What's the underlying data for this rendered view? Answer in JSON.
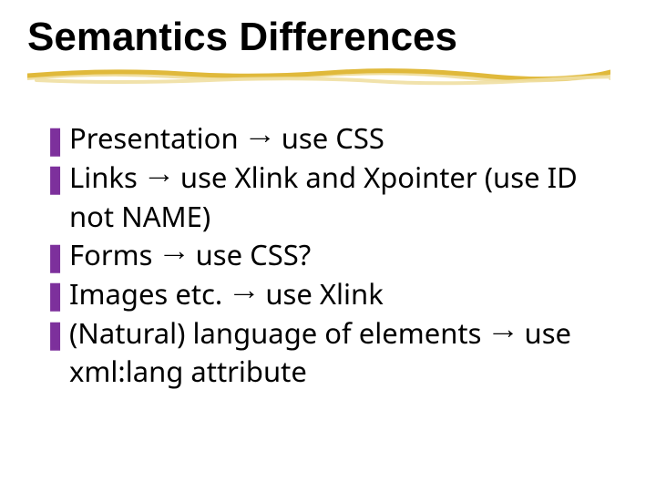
{
  "title": "Semantics Differences",
  "bullets": [
    "Presentation → use CSS",
    "Links → use Xlink and Xpointer (use ID not NAME)",
    "Forms → use CSS?",
    "Images etc. → use Xlink",
    "(Natural) language of elements → use xml:lang attribute"
  ],
  "bullet_glyph": "❚",
  "colors": {
    "bullet": "#7d309c",
    "rule_primary": "#e0b93b",
    "rule_secondary": "#f0dfa2"
  }
}
